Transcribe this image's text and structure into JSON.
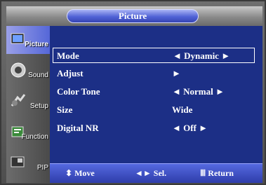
{
  "menu": {
    "title": "Picture",
    "sidebar": [
      {
        "label": "Picture",
        "icon": "picture-icon"
      },
      {
        "label": "Sound",
        "icon": "sound-icon"
      },
      {
        "label": "Setup",
        "icon": "setup-icon"
      },
      {
        "label": "Function",
        "icon": "function-icon"
      },
      {
        "label": "PIP",
        "icon": "pip-icon"
      }
    ],
    "items": [
      {
        "label": "Mode",
        "value": "◄ Dynamic ►"
      },
      {
        "label": "Adjust",
        "value": "►"
      },
      {
        "label": "Color Tone",
        "value": "◄ Normal ►"
      },
      {
        "label": "Size",
        "value": "Wide"
      },
      {
        "label": "Digital NR",
        "value": "◄ Off ►"
      }
    ],
    "hints": {
      "move_glyph": "⬍",
      "move": "Move",
      "sel_glyph": "◄►",
      "sel": "Sel.",
      "return_glyph": "Ⅲ",
      "return": "Return"
    }
  }
}
